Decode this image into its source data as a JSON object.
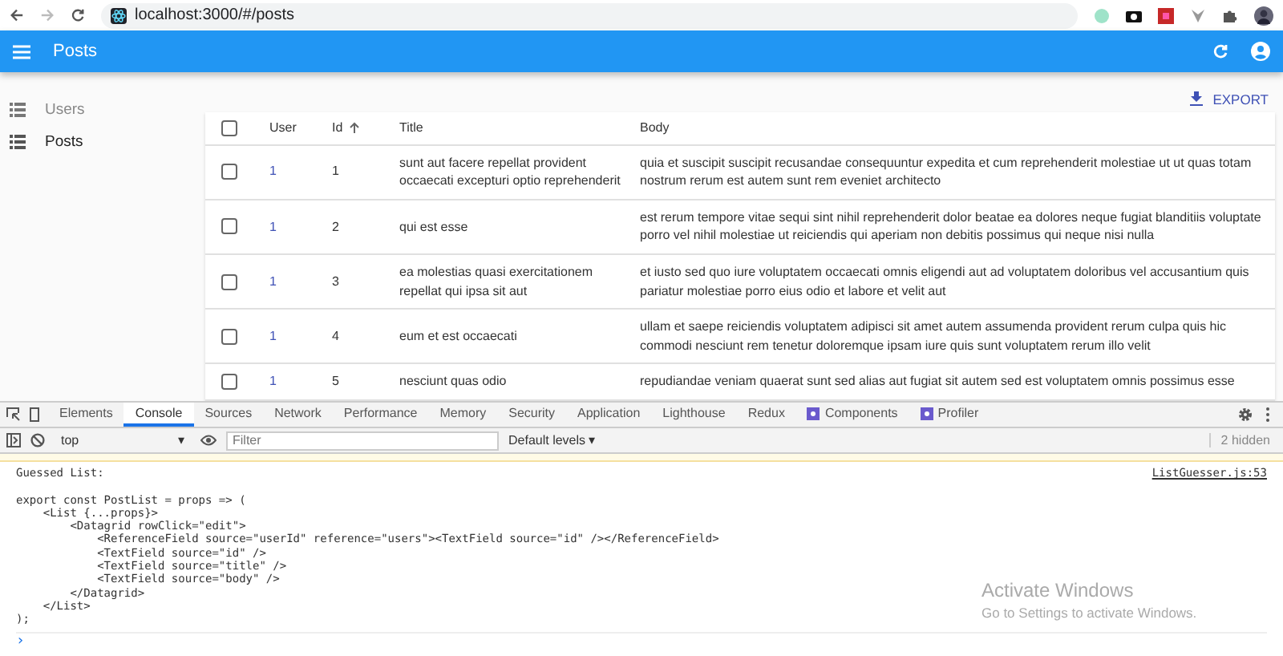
{
  "browser": {
    "url": "localhost:3000/#/posts"
  },
  "app_bar": {
    "title": "Posts"
  },
  "sidebar": {
    "items": [
      {
        "label": "Users",
        "selected": false
      },
      {
        "label": "Posts",
        "selected": true
      }
    ]
  },
  "export_button": "EXPORT",
  "table": {
    "select_all_checked": false,
    "columns": [
      {
        "label": "User",
        "sorted": false
      },
      {
        "label": "Id",
        "sorted": true
      },
      {
        "label": "Title",
        "sorted": false
      },
      {
        "label": "Body",
        "sorted": false
      }
    ],
    "rows": [
      {
        "checked": false,
        "user": "1",
        "id": "1",
        "title": "sunt aut facere repellat provident occaecati excepturi optio reprehenderit",
        "body": "quia et suscipit suscipit recusandae consequuntur expedita et cum reprehenderit molestiae ut ut quas totam nostrum rerum est autem sunt rem eveniet architecto"
      },
      {
        "checked": false,
        "user": "1",
        "id": "2",
        "title": "qui est esse",
        "body": "est rerum tempore vitae sequi sint nihil reprehenderit dolor beatae ea dolores neque fugiat blanditiis voluptate porro vel nihil molestiae ut reiciendis qui aperiam non debitis possimus qui neque nisi nulla"
      },
      {
        "checked": false,
        "user": "1",
        "id": "3",
        "title": "ea molestias quasi exercitationem repellat qui ipsa sit aut",
        "body": "et iusto sed quo iure voluptatem occaecati omnis eligendi aut ad voluptatem doloribus vel accusantium quis pariatur molestiae porro eius odio et labore et velit aut"
      },
      {
        "checked": false,
        "user": "1",
        "id": "4",
        "title": "eum et est occaecati",
        "body": "ullam et saepe reiciendis voluptatem adipisci sit amet autem assumenda provident rerum culpa quis hic commodi nesciunt rem tenetur doloremque ipsam iure quis sunt voluptatem rerum illo velit"
      },
      {
        "checked": false,
        "user": "1",
        "id": "5",
        "title": "nesciunt quas odio",
        "body": "repudiandae veniam quaerat sunt sed alias aut fugiat sit autem sed est voluptatem omnis possimus esse"
      }
    ]
  },
  "devtools": {
    "tabs": [
      {
        "label": "Elements",
        "selected": false,
        "kind": "plain"
      },
      {
        "label": "Console",
        "selected": true,
        "kind": "plain"
      },
      {
        "label": "Sources",
        "selected": false,
        "kind": "plain"
      },
      {
        "label": "Network",
        "selected": false,
        "kind": "plain"
      },
      {
        "label": "Performance",
        "selected": false,
        "kind": "plain"
      },
      {
        "label": "Memory",
        "selected": false,
        "kind": "plain"
      },
      {
        "label": "Security",
        "selected": false,
        "kind": "plain"
      },
      {
        "label": "Application",
        "selected": false,
        "kind": "plain"
      },
      {
        "label": "Lighthouse",
        "selected": false,
        "kind": "plain"
      },
      {
        "label": "Redux",
        "selected": false,
        "kind": "plain"
      },
      {
        "label": "Components",
        "selected": false,
        "kind": "react"
      },
      {
        "label": "Profiler",
        "selected": false,
        "kind": "react"
      }
    ],
    "context": "top",
    "context_caret": "▾",
    "prompt": "›",
    "filter_placeholder": "Filter",
    "levels": "Default levels ▾",
    "hidden_count": "2 hidden",
    "console": {
      "heading": "Guessed List:",
      "source_link": "ListGuesser.js:53",
      "code": [
        "export const PostList = props => (",
        "    <List {...props}>",
        "        <Datagrid rowClick=\"edit\">",
        "            <ReferenceField source=\"userId\" reference=\"users\"><TextField source=\"id\" /></ReferenceField>",
        "            <TextField source=\"id\" />",
        "            <TextField source=\"title\" />",
        "            <TextField source=\"body\" />",
        "        </Datagrid>",
        "    </List>",
        ");"
      ]
    }
  },
  "os_notice": {
    "title": "Activate Windows",
    "subtitle": "Go to Settings to activate Windows."
  }
}
